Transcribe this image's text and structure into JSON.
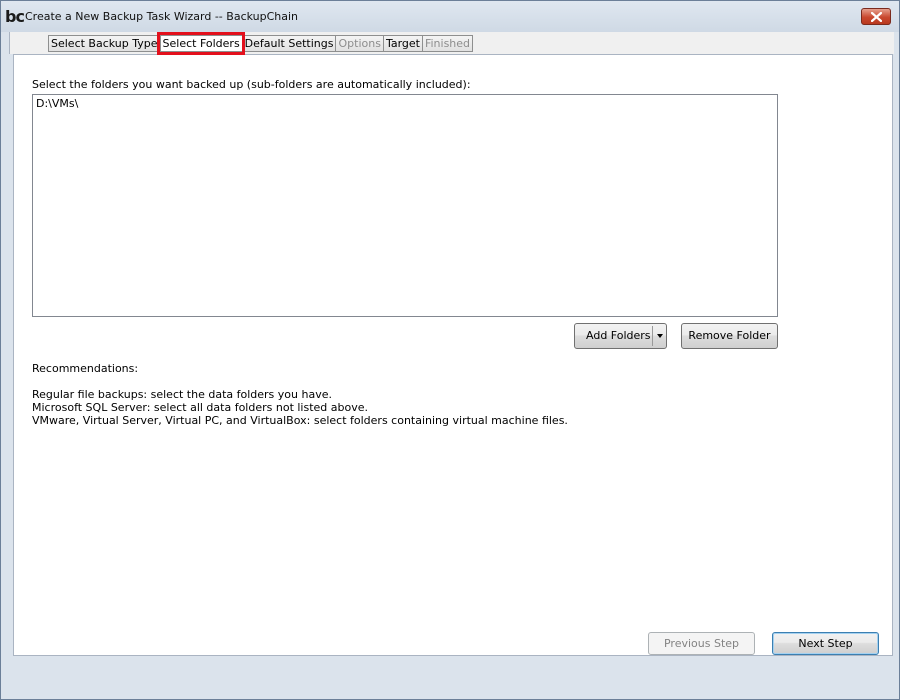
{
  "window": {
    "logo_text": "bc",
    "title": "Create a New Backup Task Wizard -- BackupChain"
  },
  "tabs": [
    {
      "label": "Select Backup Type",
      "state": "normal"
    },
    {
      "label": "Select Folders",
      "state": "active"
    },
    {
      "label": "Default Settings",
      "state": "normal"
    },
    {
      "label": "Options",
      "state": "disabled"
    },
    {
      "label": "Target",
      "state": "normal"
    },
    {
      "label": "Finished",
      "state": "disabled"
    }
  ],
  "panel": {
    "instruction": "Select the folders you want backed up (sub-folders are automatically included):",
    "folders": [
      "D:\\VMs\\"
    ],
    "add_folders_label": "Add Folders",
    "remove_folder_label": "Remove Folder",
    "recommendations_title": "Recommendations:",
    "recommendations": [
      "Regular file backups: select the data folders you have.",
      "Microsoft SQL Server: select all data folders not listed above.",
      "VMware, Virtual Server, Virtual PC, and VirtualBox: select folders containing virtual machine files."
    ]
  },
  "footer": {
    "previous_label": "Previous Step",
    "next_label": "Next Step"
  },
  "colors": {
    "active_tab_highlight": "#e3101c",
    "close_button": "#c9482f"
  },
  "icons": {
    "close": "close-icon",
    "dropdown": "chevron-down-icon"
  }
}
